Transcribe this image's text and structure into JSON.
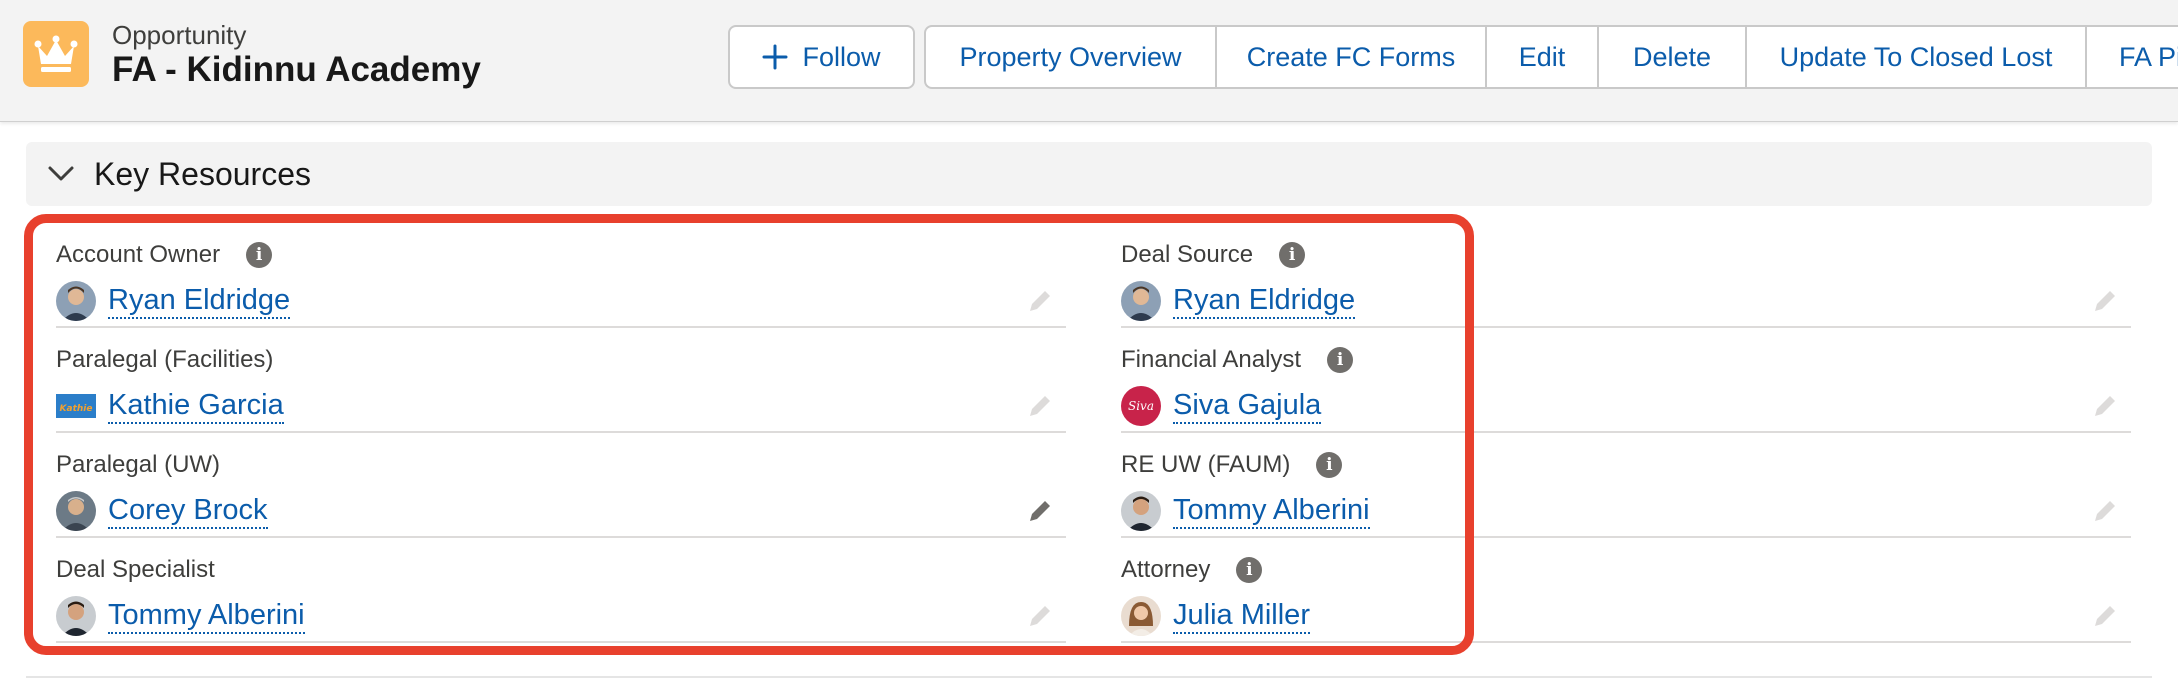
{
  "header": {
    "record_type": "Opportunity",
    "title": "FA - Kidinnu Academy",
    "follow_label": "Follow",
    "actions": [
      {
        "label": "Property Overview"
      },
      {
        "label": "Create FC Forms"
      },
      {
        "label": "Edit"
      },
      {
        "label": "Delete"
      },
      {
        "label": "Update To Closed Lost"
      },
      {
        "label": "FA Pi"
      }
    ]
  },
  "section": {
    "title": "Key Resources",
    "fields": [
      {
        "label": "Account Owner",
        "value": "Ryan Eldridge",
        "info": true
      },
      {
        "label": "Deal Source",
        "value": "Ryan Eldridge",
        "info": true
      },
      {
        "label": "Paralegal (Facilities)",
        "value": "Kathie Garcia",
        "info": false
      },
      {
        "label": "Financial Analyst",
        "value": "Siva Gajula",
        "info": true
      },
      {
        "label": "Paralegal (UW)",
        "value": "Corey Brock",
        "info": false
      },
      {
        "label": "RE UW (FAUM)",
        "value": "Tommy Alberini",
        "info": true
      },
      {
        "label": "Deal Specialist",
        "value": "Tommy Alberini",
        "info": false
      },
      {
        "label": "Attorney",
        "value": "Julia Miller",
        "info": true
      }
    ]
  },
  "avatar_text": {
    "siva": "Siva",
    "kathie": "Kathie"
  },
  "colors": {
    "link": "#0b5cab",
    "highlight": "#e8402d",
    "record_icon": "#fcb95b"
  }
}
